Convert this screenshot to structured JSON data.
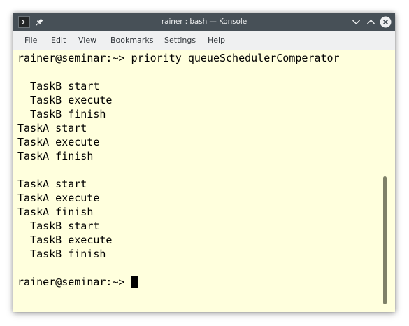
{
  "window": {
    "title": "rainer : bash — Konsole",
    "icons": {
      "app": "konsole-terminal-icon",
      "pin": "pin-icon",
      "minimize": "chevron-down-icon",
      "maximize": "chevron-up-icon",
      "close": "close-icon"
    }
  },
  "menubar": {
    "items": [
      "File",
      "Edit",
      "View",
      "Bookmarks",
      "Settings",
      "Help"
    ]
  },
  "terminal": {
    "background": "#ffffdd",
    "foreground": "#000000",
    "lines": [
      "rainer@seminar:~> priority_queueSchedulerComperator",
      "",
      "  TaskB start",
      "  TaskB execute",
      "  TaskB finish",
      "TaskA start",
      "TaskA execute",
      "TaskA finish",
      "",
      "TaskA start",
      "TaskA execute",
      "TaskA finish",
      "  TaskB start",
      "  TaskB execute",
      "  TaskB finish",
      "",
      "rainer@seminar:~> "
    ]
  }
}
